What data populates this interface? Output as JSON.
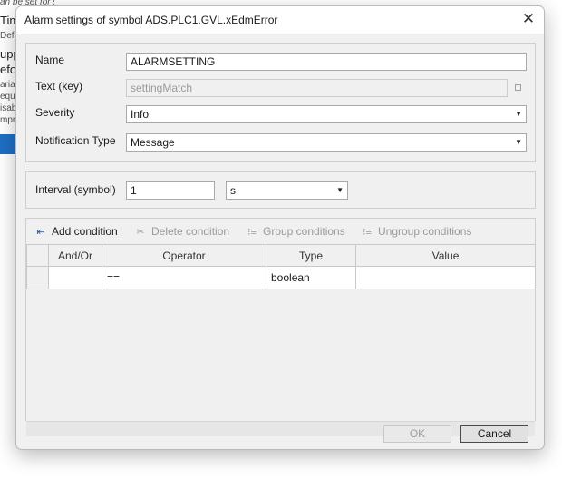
{
  "background": {
    "lines": [
      "an be set for specific remote configuration.",
      "Tim",
      "Defau",
      "upp",
      "efo",
      "arial",
      "eque",
      "isab",
      "mpro"
    ]
  },
  "dialog": {
    "title": "Alarm settings of symbol ADS.PLC1.GVL.xEdmError",
    "close_icon": "close-icon"
  },
  "form": {
    "name_label": "Name",
    "name_value": "ALARMSETTING",
    "text_key_label": "Text (key)",
    "text_key_value": "settingMatch",
    "severity_label": "Severity",
    "severity_value": "Info",
    "notification_label": "Notification Type",
    "notification_value": "Message"
  },
  "interval": {
    "label": "Interval (symbol)",
    "value": "1",
    "unit": "s"
  },
  "toolbar": {
    "add": "Add condition",
    "delete": "Delete condition",
    "group": "Group conditions",
    "ungroup": "Ungroup conditions"
  },
  "grid": {
    "columns": [
      "",
      "And/Or",
      "Operator",
      "Type",
      "Value"
    ],
    "rows": [
      [
        "",
        "",
        "==",
        "boolean",
        ""
      ]
    ]
  },
  "buttons": {
    "ok": "OK",
    "cancel": "Cancel"
  }
}
